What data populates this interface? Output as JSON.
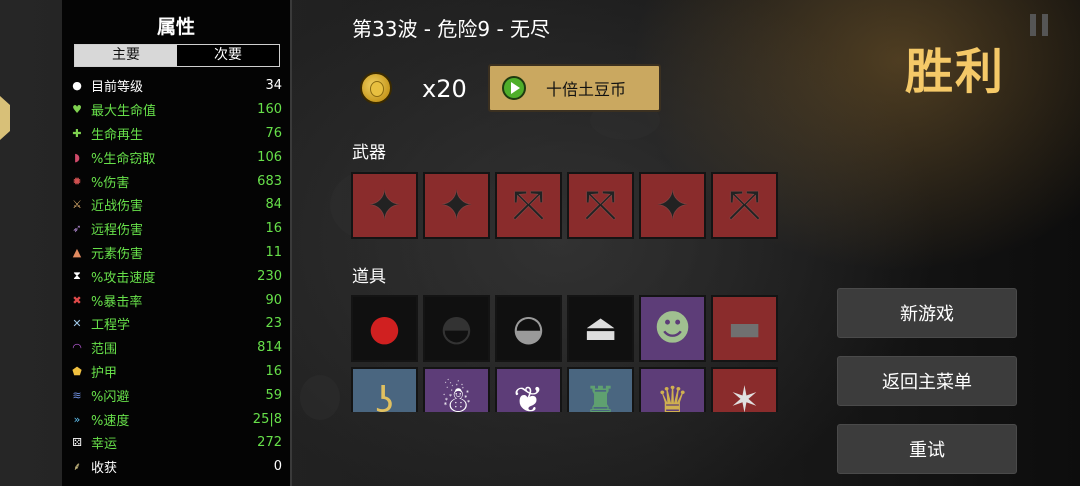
{
  "stats_panel": {
    "title": "属性",
    "tabs": [
      {
        "label": "主要",
        "active": true
      },
      {
        "label": "次要",
        "active": false
      }
    ],
    "rows": [
      {
        "label": "目前等级",
        "value": "34",
        "icon": "level-icon",
        "glyph": "●",
        "icon_color": "#ffffff",
        "color": "white"
      },
      {
        "label": "最大生命值",
        "value": "160",
        "icon": "heart-icon",
        "glyph": "♥",
        "icon_color": "#7ed04f",
        "color": "green"
      },
      {
        "label": "生命再生",
        "value": "76",
        "icon": "regen-icon",
        "glyph": "✚",
        "icon_color": "#7ed04f",
        "color": "green"
      },
      {
        "label": "%生命窃取",
        "value": "106",
        "icon": "lifesteal-icon",
        "glyph": "◗",
        "icon_color": "#d04a6a",
        "color": "green"
      },
      {
        "label": "%伤害",
        "value": "683",
        "icon": "damage-icon",
        "glyph": "✹",
        "icon_color": "#d05050",
        "color": "green"
      },
      {
        "label": "近战伤害",
        "value": "84",
        "icon": "sword-icon",
        "glyph": "⚔",
        "icon_color": "#e0b070",
        "color": "green"
      },
      {
        "label": "远程伤害",
        "value": "16",
        "icon": "bow-icon",
        "glyph": "➶",
        "icon_color": "#b088d0",
        "color": "green"
      },
      {
        "label": "元素伤害",
        "value": "11",
        "icon": "fire-icon",
        "glyph": "▲",
        "icon_color": "#e08a60",
        "color": "green"
      },
      {
        "label": "%攻击速度",
        "value": "230",
        "icon": "hourglass-icon",
        "glyph": "⧗",
        "icon_color": "#ffffff",
        "color": "green"
      },
      {
        "label": "%暴击率",
        "value": "90",
        "icon": "crit-icon",
        "glyph": "✖",
        "icon_color": "#e04a4a",
        "color": "green"
      },
      {
        "label": "工程学",
        "value": "23",
        "icon": "wrench-icon",
        "glyph": "✕",
        "icon_color": "#a0c8e8",
        "color": "green"
      },
      {
        "label": "范围",
        "value": "814",
        "icon": "range-icon",
        "glyph": "◠",
        "icon_color": "#c060e0",
        "color": "green"
      },
      {
        "label": "护甲",
        "value": "16",
        "icon": "shield-icon",
        "glyph": "⬟",
        "icon_color": "#f0c040",
        "color": "green"
      },
      {
        "label": "%闪避",
        "value": "59",
        "icon": "dodge-icon",
        "glyph": "≋",
        "icon_color": "#7090e0",
        "color": "green"
      },
      {
        "label": "%速度",
        "value": "25|8",
        "icon": "speed-icon",
        "glyph": "»",
        "icon_color": "#60c0f0",
        "color": "green"
      },
      {
        "label": "幸运",
        "value": "272",
        "icon": "dice-icon",
        "glyph": "⚄",
        "icon_color": "#ffffff",
        "color": "green"
      },
      {
        "label": "收获",
        "value": "0",
        "icon": "harvest-icon",
        "glyph": "⸙",
        "icon_color": "#e0d090",
        "color": "white"
      }
    ]
  },
  "header": {
    "wave_title": "第33波 - 危险9 - 无尽",
    "coin_count": "x20",
    "ad_button_label": "十倍土豆币"
  },
  "weapons": {
    "label": "武器",
    "slots": [
      {
        "icon": "shuriken-icon",
        "glyph": "✦",
        "tier": "red"
      },
      {
        "icon": "shuriken-icon",
        "glyph": "✦",
        "tier": "red"
      },
      {
        "icon": "crossbow-icon",
        "glyph": "⤧",
        "tier": "red"
      },
      {
        "icon": "crossbow-icon",
        "glyph": "⤧",
        "tier": "red"
      },
      {
        "icon": "shuriken-icon",
        "glyph": "✦",
        "tier": "red"
      },
      {
        "icon": "crossbow-icon",
        "glyph": "⤧",
        "tier": "red"
      }
    ]
  },
  "items": {
    "label": "道具",
    "rows": [
      [
        {
          "icon": "boxing-glove-icon",
          "glyph": "●",
          "tier": "black",
          "color": "#d02020"
        },
        {
          "icon": "beanie-hat-icon",
          "glyph": "◓",
          "tier": "black",
          "color": "#333333"
        },
        {
          "icon": "helmet-icon",
          "glyph": "◒",
          "tier": "black",
          "color": "#9a9a9a"
        },
        {
          "icon": "rocket-icon",
          "glyph": "⏏",
          "tier": "black",
          "color": "#dddddd"
        },
        {
          "icon": "zombie-mask-icon",
          "glyph": "☻",
          "tier": "purple",
          "color": "#a0c090"
        },
        {
          "icon": "anvil-icon",
          "glyph": "▬",
          "tier": "red",
          "color": "#707070"
        }
      ],
      [
        {
          "icon": "hook-icon",
          "glyph": "ʖ",
          "tier": "blue",
          "color": "#e0c060"
        },
        {
          "icon": "ghost-figure-icon",
          "glyph": "☃",
          "tier": "purple",
          "color": "#ffffff"
        },
        {
          "icon": "wings-icon",
          "glyph": "❦",
          "tier": "purple",
          "color": "#ffffff"
        },
        {
          "icon": "robot-turret-icon",
          "glyph": "♜",
          "tier": "blue",
          "color": "#5fa070"
        },
        {
          "icon": "crown-icon",
          "glyph": "♛",
          "tier": "purple",
          "color": "#d0b050"
        },
        {
          "icon": "bloody-claw-icon",
          "glyph": "✶",
          "tier": "red",
          "color": "#e0e0e0"
        }
      ]
    ]
  },
  "right": {
    "result_title": "胜利",
    "buttons": [
      "新游戏",
      "返回主菜单",
      "重试"
    ]
  },
  "colors": {
    "victory": "#f5c968",
    "stat_green": "#67e04a",
    "tier_red": "#8a2c2c",
    "tier_purple": "#5d3d78",
    "tier_blue": "#4a6680"
  }
}
